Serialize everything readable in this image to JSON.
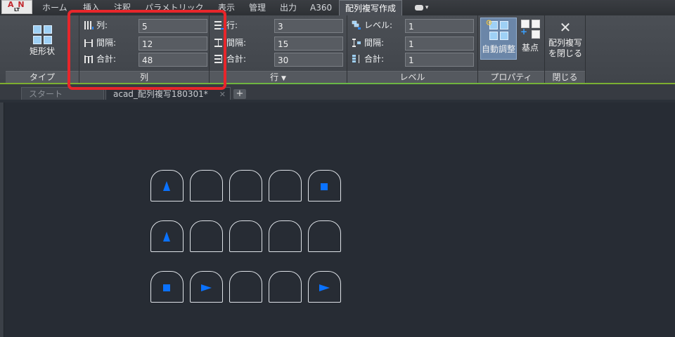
{
  "app": {
    "logo_mark": "A N",
    "logo_label": "LT"
  },
  "menu_tabs": [
    "ホーム",
    "挿入",
    "注釈",
    "パラメトリック",
    "表示",
    "管理",
    "出力",
    "A360",
    "配列複写作成"
  ],
  "ribbon": {
    "type_panel": {
      "button_label": "矩形状",
      "title": "タイプ"
    },
    "columns_panel": {
      "title": "列",
      "count_label": "列:",
      "count_value": "5",
      "spacing_label": "間隔:",
      "spacing_value": "12",
      "total_label": "合計:",
      "total_value": "48"
    },
    "rows_panel": {
      "title": "行",
      "count_label": "行:",
      "count_value": "3",
      "spacing_label": "間隔:",
      "spacing_value": "15",
      "total_label": "合計:",
      "total_value": "30"
    },
    "levels_panel": {
      "title": "レベル",
      "count_label": "レベル:",
      "count_value": "1",
      "spacing_label": "間隔:",
      "spacing_value": "1",
      "total_label": "合計:",
      "total_value": "1"
    },
    "properties_panel": {
      "title": "プロパティ",
      "associative_label": "自動調整",
      "basepoint_label": "基点"
    },
    "close_panel": {
      "title": "閉じる",
      "close_label_line1": "配列複写",
      "close_label_line2": "を閉じる"
    }
  },
  "doc_tabs": [
    "スタート",
    "acad_配列複写180301*"
  ],
  "colors": {
    "accent_blue": "#0a72ff",
    "highlight_red": "#e8262b",
    "ribbon_green": "#69b847"
  },
  "drawing": {
    "rows": [
      [
        "triangle-up",
        "none",
        "none",
        "none",
        "square"
      ],
      [
        "triangle-up",
        "none",
        "none",
        "none",
        "none"
      ],
      [
        "square",
        "triangle-right",
        "none",
        "none",
        "triangle-right"
      ]
    ]
  }
}
